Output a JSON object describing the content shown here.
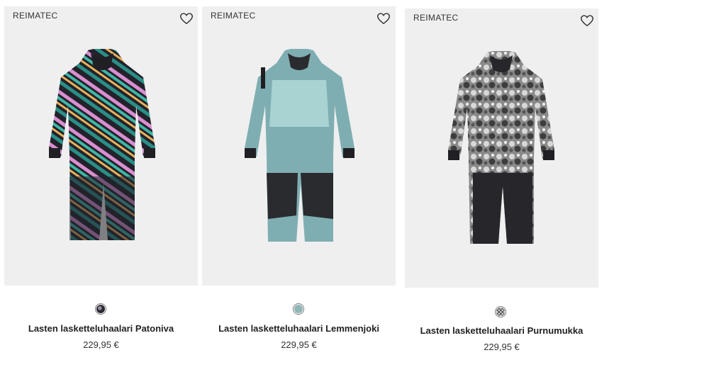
{
  "products": [
    {
      "brand": "REIMATEC",
      "name": "Lasten lasketteluhaalari Patoniva",
      "price": "229,95 €",
      "swatch_color": "#2b2a33",
      "swatch_icon": "multicolor-pattern-swatch"
    },
    {
      "brand": "REIMATEC",
      "name": "Lasten lasketteluhaalari Lemmenjoki",
      "price": "229,95 €",
      "swatch_color": "#8fb6b4",
      "swatch_icon": "teal-swatch"
    },
    {
      "brand": "REIMATEC",
      "name": "Lasten lasketteluhaalari Purnumukka",
      "price": "229,95 €",
      "swatch_color": "#6b6b6b",
      "swatch_icon": "grey-pattern-swatch"
    }
  ],
  "colors": {
    "image_bg": "#efefef",
    "text": "#222222"
  }
}
